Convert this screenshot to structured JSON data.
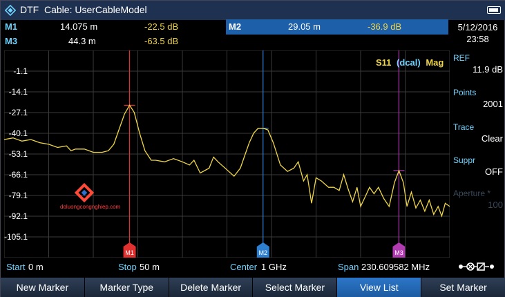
{
  "header": {
    "mode": "DTF",
    "cable_label": "Cable: UserCableModel"
  },
  "markers": [
    {
      "label": "M1",
      "distance": "14.075 m",
      "value": "-22.5 dB"
    },
    {
      "label": "M2",
      "distance": "29.05 m",
      "value": "-36.9 dB"
    },
    {
      "label": "M3",
      "distance": "44.3 m",
      "value": "-63.5 dB"
    }
  ],
  "datetime": {
    "date": "5/12/2016",
    "time": "23:58"
  },
  "trace_title": {
    "param": "S11",
    "cal": "(dcal)",
    "format": "Mag"
  },
  "y_ticks": [
    "-1.1",
    "-14.1",
    "-27.1",
    "-40.1",
    "-53.1",
    "-66.1",
    "-79.1",
    "-92.1",
    "-105.1"
  ],
  "plot_markers": [
    {
      "label": "M1",
      "color": "#e03030"
    },
    {
      "label": "M2",
      "color": "#2f7fd0"
    },
    {
      "label": "M3",
      "color": "#b03ab0"
    }
  ],
  "side": [
    {
      "label": "REF",
      "value": "11.9 dB",
      "enabled": true
    },
    {
      "label": "Points",
      "value": "2001",
      "enabled": true
    },
    {
      "label": "Trace",
      "value": "Clear",
      "enabled": true
    },
    {
      "label": "Suppr",
      "value": "OFF",
      "enabled": true
    },
    {
      "label": "Aperture *",
      "value": "100",
      "enabled": false
    }
  ],
  "status": {
    "start_label": "Start",
    "start_value": "0 m",
    "stop_label": "Stop",
    "stop_value": "50 m",
    "center_label": "Center",
    "center_value": "1 GHz",
    "span_label": "Span",
    "span_value": "230.609582 MHz"
  },
  "softkeys": [
    "New Marker",
    "Marker Type",
    "Delete Marker",
    "Select Marker",
    "View List",
    "Set Marker"
  ],
  "active_softkey": "View List",
  "watermark": "doluongcongnghiep.com",
  "colors": {
    "trace": "#f0d646",
    "label": "#6fd3ff",
    "highlight": "#1d5fa8",
    "titlebar": "#1f3150"
  },
  "chart_data": {
    "type": "line",
    "x_range": [
      0,
      50
    ],
    "ylim": [
      -118.1,
      11.9
    ],
    "series": [
      {
        "x": [
          0,
          1,
          2,
          3,
          4,
          5,
          6,
          7,
          7.5,
          8,
          9,
          10,
          11,
          11.7,
          12.3,
          13,
          13.5,
          14.075,
          14.6,
          15.2,
          15.8,
          16.5,
          17,
          18,
          19,
          20,
          20.8,
          21.3,
          22,
          23,
          23.5,
          24,
          25,
          25.8,
          26.5,
          27,
          27.5,
          28,
          28.5,
          29.05,
          29.6,
          30.2,
          31,
          31.8,
          32.5,
          33,
          33.6,
          34,
          34.5,
          35,
          35.6,
          36.4,
          37,
          37.6,
          38.1,
          38.6,
          39.1,
          39.6,
          40,
          40.5,
          41,
          41.5,
          42,
          42.6,
          43.2,
          43.8,
          44.3,
          44.8,
          45.2,
          45.7,
          46.2,
          46.7,
          47.2,
          47.7,
          48.2,
          48.7,
          49.1,
          49.5,
          50
        ],
        "values": [
          -44,
          -43,
          -45,
          -44,
          -46,
          -47,
          -49,
          -48,
          -51,
          -50,
          -50,
          -52,
          -52,
          -51,
          -47,
          -36,
          -28,
          -22.5,
          -27,
          -40,
          -51,
          -57,
          -57,
          -58,
          -56,
          -58,
          -60,
          -57,
          -65,
          -62,
          -55,
          -58,
          -63,
          -67,
          -62,
          -54,
          -46,
          -40,
          -37,
          -36.9,
          -38,
          -46,
          -60,
          -64,
          -62,
          -58,
          -70,
          -66,
          -84,
          -68,
          -70,
          -74,
          -74,
          -76,
          -66,
          -75,
          -83,
          -74,
          -86,
          -80,
          -74,
          -78,
          -74,
          -81,
          -86,
          -71,
          -63.5,
          -71,
          -86,
          -77,
          -87,
          -82,
          -89,
          -82,
          -91,
          -86,
          -92,
          -84,
          -86
        ]
      }
    ],
    "markers_x": [
      14.075,
      29.05,
      44.3
    ],
    "grid": true
  }
}
